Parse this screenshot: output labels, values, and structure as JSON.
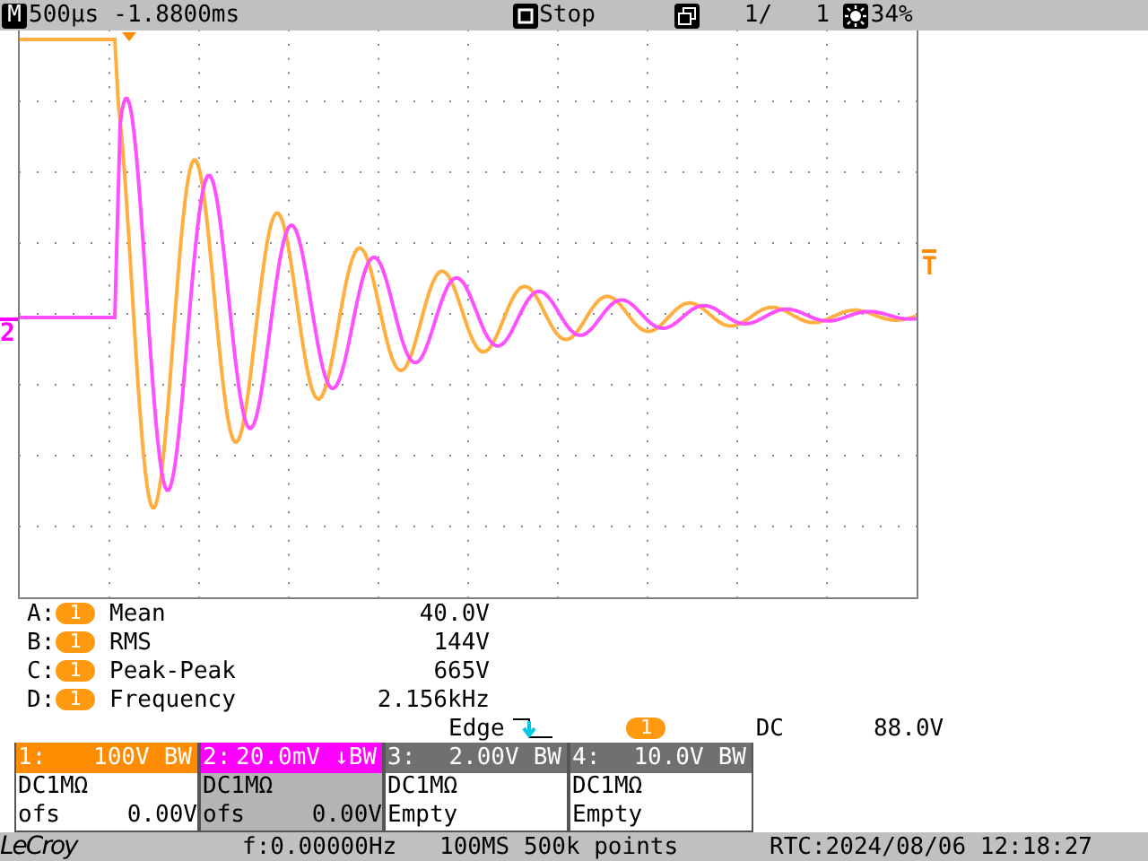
{
  "top_bar": {
    "mode_badge": "M",
    "timebase": "500µs",
    "delay": "-1.8800ms",
    "run_state": "Stop",
    "acq_count": "1/",
    "acq_total": "1",
    "intensity": "34%"
  },
  "scope": {
    "channel_marker": "2",
    "trigger_level_marker": "T"
  },
  "measurements": [
    {
      "slot": "A:",
      "source": "1",
      "name": "Mean",
      "value": "40.0V"
    },
    {
      "slot": "B:",
      "source": "1",
      "name": "RMS",
      "value": "144V"
    },
    {
      "slot": "C:",
      "source": "1",
      "name": "Peak-Peak",
      "value": "665V"
    },
    {
      "slot": "D:",
      "source": "1",
      "name": "Frequency",
      "value": "2.156kHz"
    }
  ],
  "trigger": {
    "type": "Edge",
    "source": "1",
    "coupling": "DC",
    "level": "88.0V"
  },
  "channels": [
    {
      "label": "1:",
      "scale": "100V",
      "bw": "BW",
      "coupling": "DC1MΩ",
      "offset_label": "ofs",
      "offset": "0.00V",
      "color": "#ff8c00",
      "selected": false
    },
    {
      "label": "2:",
      "scale": "20.0mV",
      "bw": "↓BW",
      "coupling": "DC1MΩ",
      "offset_label": "ofs",
      "offset": "0.00V",
      "color": "#ff00ff",
      "selected": true
    },
    {
      "label": "3:",
      "scale": "2.00V",
      "bw": "BW",
      "coupling": "DC1MΩ",
      "status": "Empty",
      "color": "#707070",
      "selected": false
    },
    {
      "label": "4:",
      "scale": "10.0V",
      "bw": "BW",
      "coupling": "DC1MΩ",
      "status": "Empty",
      "color": "#707070",
      "selected": false
    }
  ],
  "status_bar": {
    "brand": "LeCroy",
    "frequency": "f:0.00000Hz",
    "sample_info": "100MS 500k points",
    "rtc": "RTC:2024/08/06 12:18:27"
  }
}
